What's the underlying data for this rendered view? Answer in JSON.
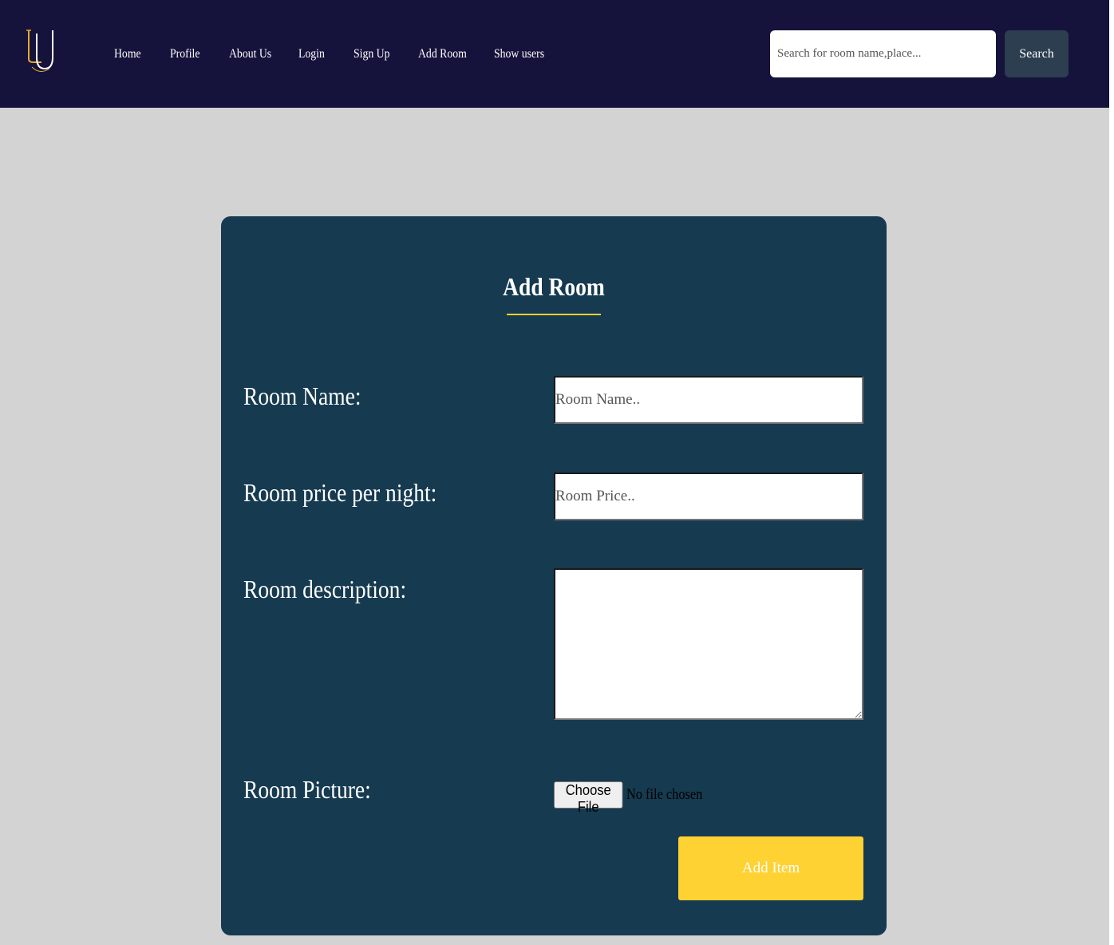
{
  "navbar": {
    "logo": {
      "text": "LU",
      "icon": "lu-monogram-logo",
      "accent": "#e5a82b"
    },
    "links": [
      "Home",
      "Profile",
      "About Us",
      "Login",
      "Sign Up",
      "Add Room",
      "Show users"
    ],
    "search": {
      "placeholder": "Search for room name,place...",
      "button_label": "Search"
    }
  },
  "form": {
    "title": "Add Room",
    "fields": {
      "room_name": {
        "label": "Room Name:",
        "placeholder": "Room Name.."
      },
      "room_price": {
        "label": "Room price per night:",
        "placeholder": "Room Price.."
      },
      "room_description": {
        "label": "Room description:",
        "value": ""
      },
      "room_picture": {
        "label": "Room Picture:",
        "button_label": "Choose File",
        "status": "No file chosen"
      }
    },
    "submit_label": "Add Item"
  },
  "colors": {
    "navbar_bg": "#15133c",
    "page_bg": "#d3d3d3",
    "card_bg": "#163a50",
    "accent_yellow": "#ffd233",
    "search_button_bg": "#2c3e50"
  }
}
